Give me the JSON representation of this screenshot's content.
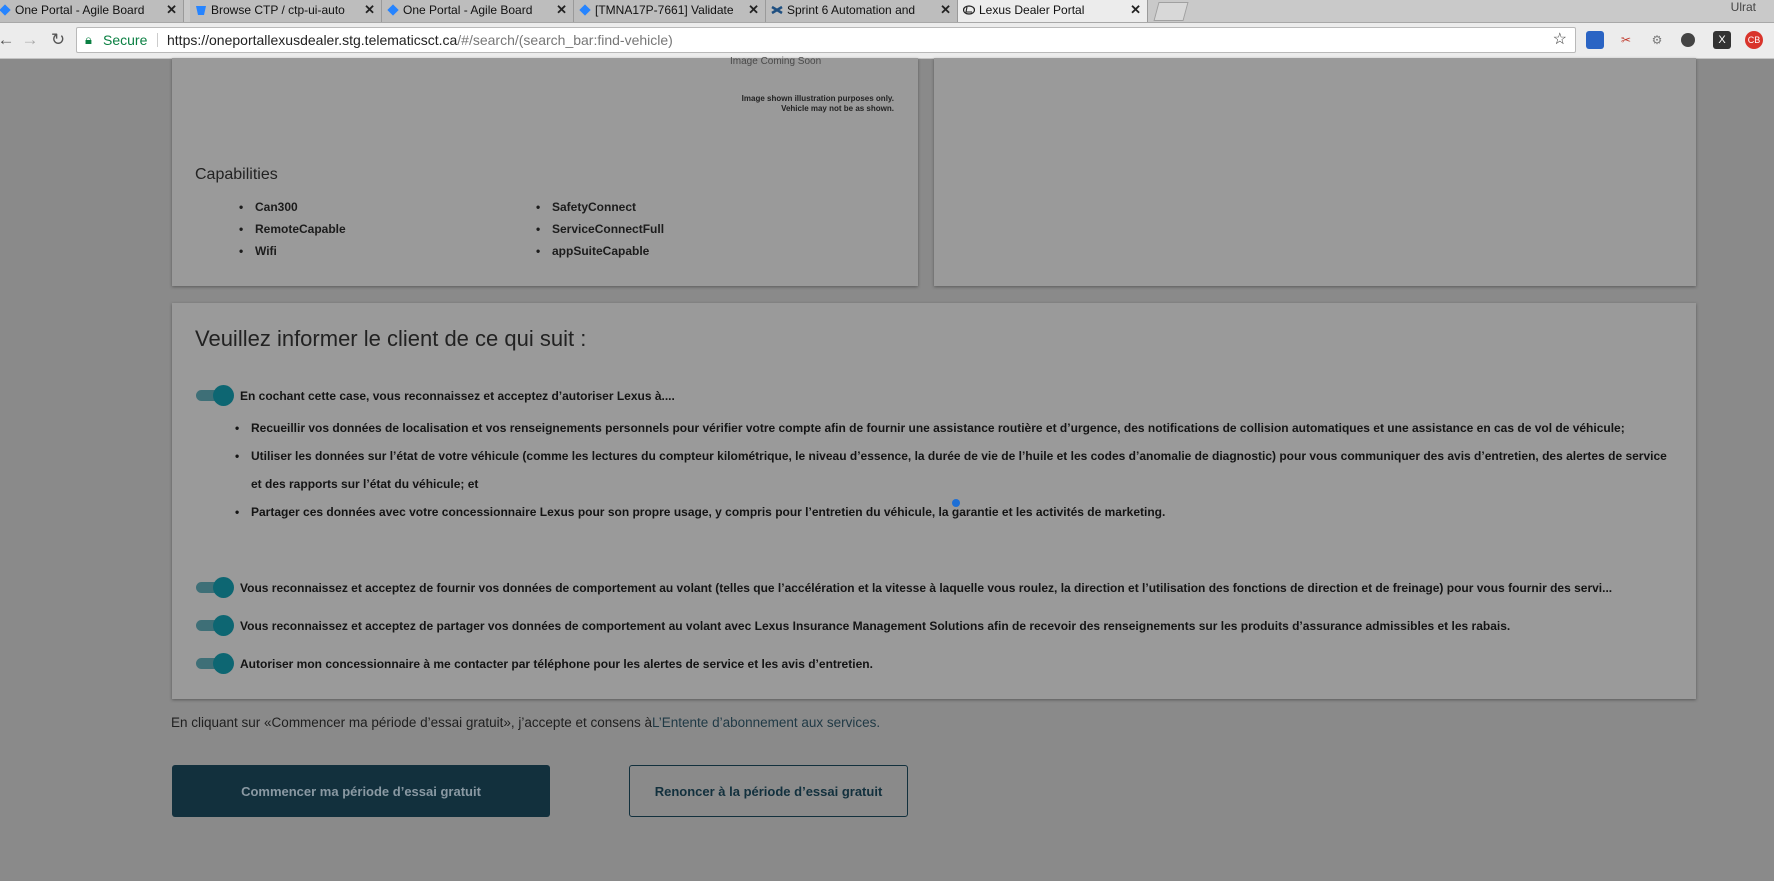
{
  "browser": {
    "tabs": [
      {
        "label": "One Portal - Agile Board",
        "icon": "jira-icon"
      },
      {
        "label": "Browse CTP / ctp-ui-auto",
        "icon": "bitbucket-icon"
      },
      {
        "label": "One Portal - Agile Board",
        "icon": "jira-icon"
      },
      {
        "label": "[TMNA17P-7661] Validate",
        "icon": "jira-icon"
      },
      {
        "label": "Sprint 6 Automation and",
        "icon": "confluence-icon"
      },
      {
        "label": "Lexus Dealer Portal",
        "icon": "lexus-icon",
        "active": true
      }
    ],
    "user_label": "Ulrat",
    "address": {
      "secure_label": "Secure",
      "url_host": "https://oneportallexusdealer.stg.telematicsct.ca",
      "url_path": "/#/search/(search_bar:find-vehicle)"
    },
    "colors": {
      "secure": "#0b8043"
    }
  },
  "vehicle": {
    "image_placeholder": "Image Coming Soon",
    "image_disclaimer_line1": "Image shown illustration purposes only.",
    "image_disclaimer_line2": "Vehicle may not be as shown.",
    "capabilities_title": "Capabilities",
    "capabilities_col1": [
      "Can300",
      "RemoteCapable",
      "Wifi"
    ],
    "capabilities_col2": [
      "SafetyConnect",
      "ServiceConnectFull",
      "appSuiteCapable"
    ]
  },
  "consent": {
    "title": "Veuillez informer le client de ce qui suit :",
    "items": [
      {
        "text": "En cochant cette case, vous reconnaissez et acceptez d’autoriser Lexus à....",
        "checked": true
      },
      {
        "text": "Vous reconnaissez et acceptez de fournir vos données de comportement au volant (telles que l’accélération et la vitesse à laquelle vous roulez, la direction et l’utilisation des fonctions de direction et de freinage) pour vous fournir des servi...",
        "checked": true
      },
      {
        "text": "Vous reconnaissez et acceptez de partager vos données de comportement au volant avec Lexus Insurance Management Solutions afin de recevoir des renseignements sur les produits d’assurance admissibles et les rabais.",
        "checked": true
      },
      {
        "text": "Autoriser mon concessionnaire à me contacter par téléphone pour les alertes de service et les avis d’entretien.",
        "checked": true
      }
    ],
    "bullets": [
      "Recueillir vos données de localisation et vos renseignements personnels pour vérifier votre compte afin de fournir une assistance routière et d’urgence, des notifications de collision automatiques et une assistance en cas de vol de véhicule;",
      "Utiliser les données sur l’état de votre véhicule (comme les lectures du compteur kilométrique, le niveau d’essence, la durée de vie de l’huile et les codes d’anomalie de diagnostic) pour vous communiquer des avis d’entretien, des alertes de service et des rapports sur l’état du véhicule; et",
      "Partager ces données avec votre concessionnaire Lexus pour son propre usage, y compris pour l’entretien du véhicule, la garantie et les activités de marketing."
    ]
  },
  "footer": {
    "terms_prefix": "En cliquant sur «Commencer ma période d’essai gratuit», j’accepte et consens à",
    "terms_link": "L’Entente d’abonnement aux services.",
    "start_button": "Commencer ma période d’essai gratuit",
    "decline_button": "Renoncer à la période d’essai gratuit",
    "colors": {
      "primary": "#12303d",
      "toggle": "#0d6672"
    }
  }
}
